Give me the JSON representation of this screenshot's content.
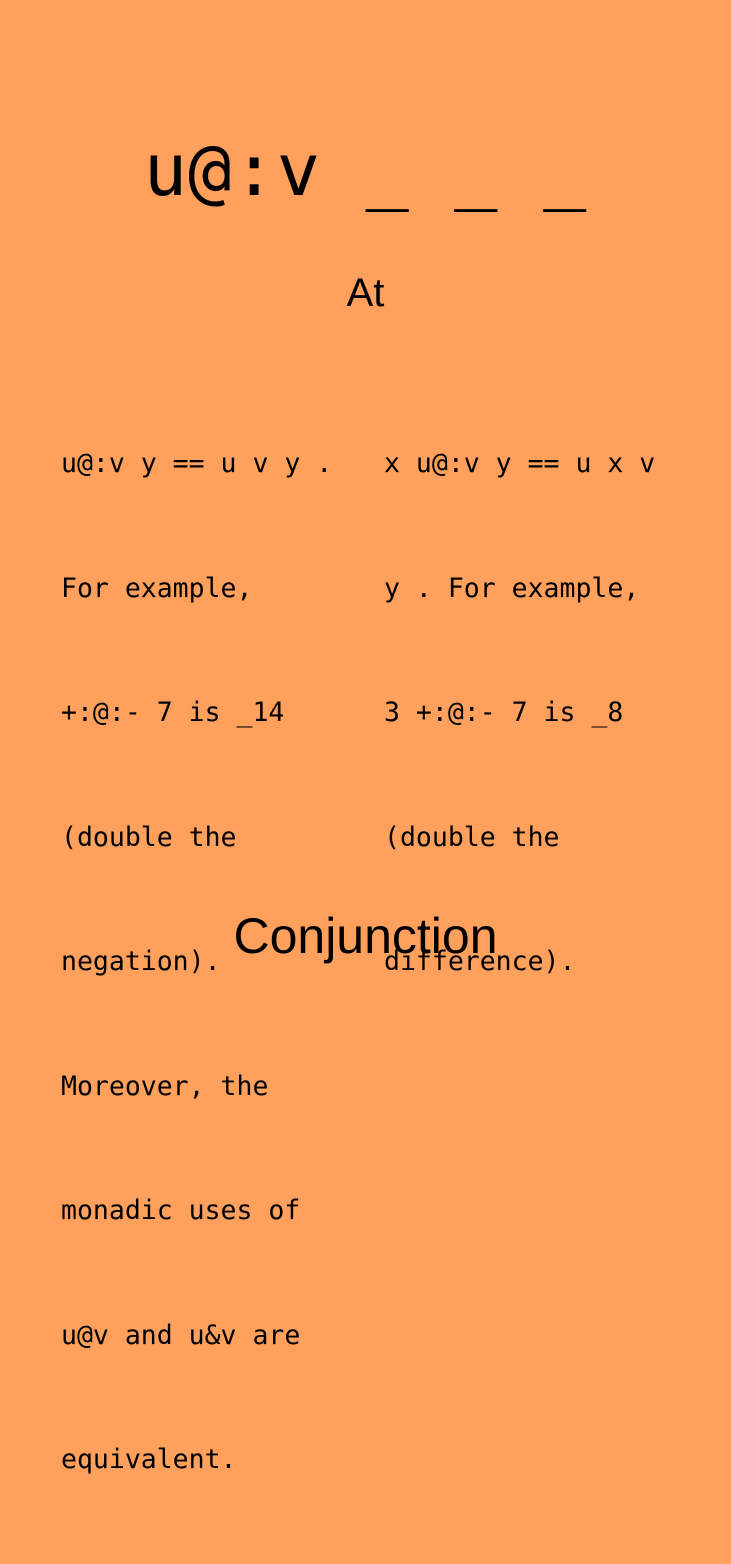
{
  "card": {
    "signature": "u@:v _ _ _",
    "name": "At",
    "monadic_lines": [
      "u@:v y == u v y .",
      "For example,",
      "+:@:- 7 is _14",
      "(double the",
      "negation).",
      "Moreover, the",
      "monadic uses of",
      "u@v and u&v are",
      "equivalent."
    ],
    "dyadic_lines": [
      "x u@:v y == u x v",
      "y . For example,",
      "3 +:@:- 7 is _8",
      "(double the",
      "difference)."
    ],
    "category": "Conjunction"
  },
  "colors": {
    "background": "#ffa05d",
    "text": "#000000"
  }
}
